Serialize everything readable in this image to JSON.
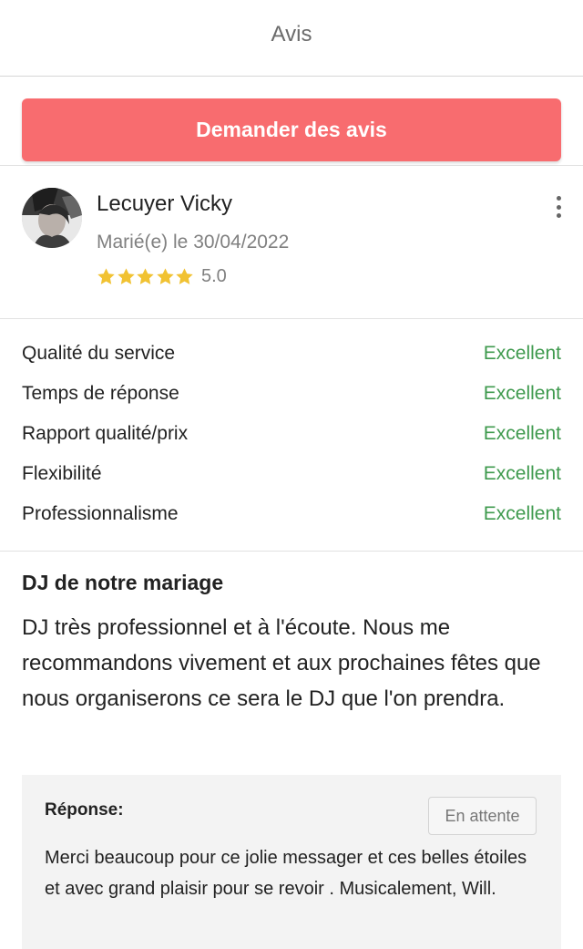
{
  "header": {
    "title": "Avis"
  },
  "cta": {
    "label": "Demander des avis"
  },
  "review": {
    "reviewer_name": "Lecuyer Vicky",
    "married_date": "Marié(e) le 30/04/2022",
    "stars": 5,
    "rating_value": "5.0",
    "criteria": [
      {
        "label": "Qualité du service",
        "value": "Excellent"
      },
      {
        "label": "Temps de réponse",
        "value": "Excellent"
      },
      {
        "label": "Rapport qualité/prix",
        "value": "Excellent"
      },
      {
        "label": "Flexibilité",
        "value": "Excellent"
      },
      {
        "label": "Professionnalisme",
        "value": "Excellent"
      }
    ],
    "title": "DJ de notre mariage",
    "body": "DJ très professionnel et à l'écoute. Nous me recommandons vivement et aux prochaines fêtes que nous organiserons ce sera le DJ que l'on prendra."
  },
  "reply": {
    "label": "Réponse:",
    "status": "En attente",
    "text": "Merci beaucoup pour ce jolie messager et ces belles étoiles et avec grand plaisir pour se revoir . Musicalement, Will."
  },
  "icons": {
    "star": "star-icon",
    "more": "kebab-menu-icon",
    "avatar": "reviewer-avatar"
  },
  "colors": {
    "accent": "#f86c6f",
    "star": "#f1c232",
    "excellent": "#3f9a4e"
  }
}
